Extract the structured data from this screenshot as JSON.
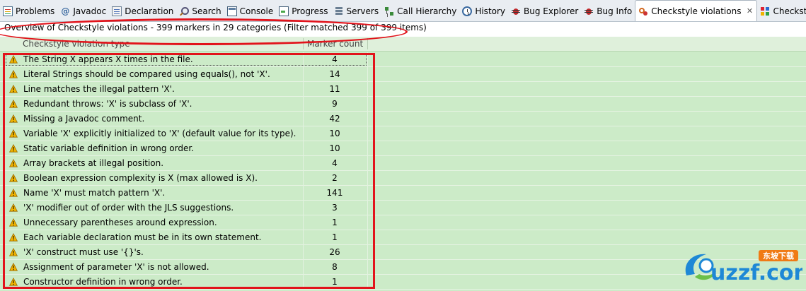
{
  "tabs": [
    {
      "label": "Problems",
      "icon": "problems-icon"
    },
    {
      "label": "Javadoc",
      "icon": "javadoc-icon"
    },
    {
      "label": "Declaration",
      "icon": "declaration-icon"
    },
    {
      "label": "Search",
      "icon": "search-icon"
    },
    {
      "label": "Console",
      "icon": "console-icon"
    },
    {
      "label": "Progress",
      "icon": "progress-icon"
    },
    {
      "label": "Servers",
      "icon": "servers-icon"
    },
    {
      "label": "Call Hierarchy",
      "icon": "call-hierarchy-icon"
    },
    {
      "label": "History",
      "icon": "history-icon"
    },
    {
      "label": "Bug Explorer",
      "icon": "bug-icon"
    },
    {
      "label": "Bug Info",
      "icon": "bug-icon"
    },
    {
      "label": "Checkstyle violations",
      "icon": "checkstyle-icon",
      "active": true,
      "close": "✕"
    },
    {
      "label": "Checkstyle violati",
      "icon": "checkstyle-charts-icon"
    }
  ],
  "overview": "Overview of Checkstyle violations - 399 markers in 29 categories (Filter matched 399 of 399 items)",
  "table": {
    "columns": [
      "Checkstyle violation type",
      "Marker count"
    ],
    "rows": [
      {
        "type": "The String X appears X times in the file.",
        "count": "4"
      },
      {
        "type": "Literal Strings should be compared using equals(), not 'X'.",
        "count": "14"
      },
      {
        "type": "Line matches the illegal pattern 'X'.",
        "count": "11"
      },
      {
        "type": "Redundant throws: 'X' is subclass of 'X'.",
        "count": "9"
      },
      {
        "type": "Missing a Javadoc comment.",
        "count": "42"
      },
      {
        "type": "Variable 'X' explicitly initialized to 'X' (default value for its type).",
        "count": "10"
      },
      {
        "type": "Static variable definition in wrong order.",
        "count": "10"
      },
      {
        "type": "Array brackets at illegal position.",
        "count": "4"
      },
      {
        "type": "Boolean expression complexity is X (max allowed is X).",
        "count": "2"
      },
      {
        "type": "Name 'X' must match pattern 'X'.",
        "count": "141"
      },
      {
        "type": "'X' modifier out of order with the JLS suggestions.",
        "count": "3"
      },
      {
        "type": "Unnecessary parentheses around expression.",
        "count": "1"
      },
      {
        "type": "Each variable declaration must be in its own statement.",
        "count": "1"
      },
      {
        "type": "'X' construct must use '{}'s.",
        "count": "26"
      },
      {
        "type": "Assignment of parameter 'X' is not allowed.",
        "count": "8"
      },
      {
        "type": "Constructor definition in wrong order.",
        "count": "1"
      }
    ]
  },
  "watermark": {
    "text": "uzzf.com",
    "tag": "东坡下载"
  },
  "colors": {
    "row_bg": "#ccebc8",
    "annotation": "#e2131b",
    "warning": "#f0b400"
  }
}
